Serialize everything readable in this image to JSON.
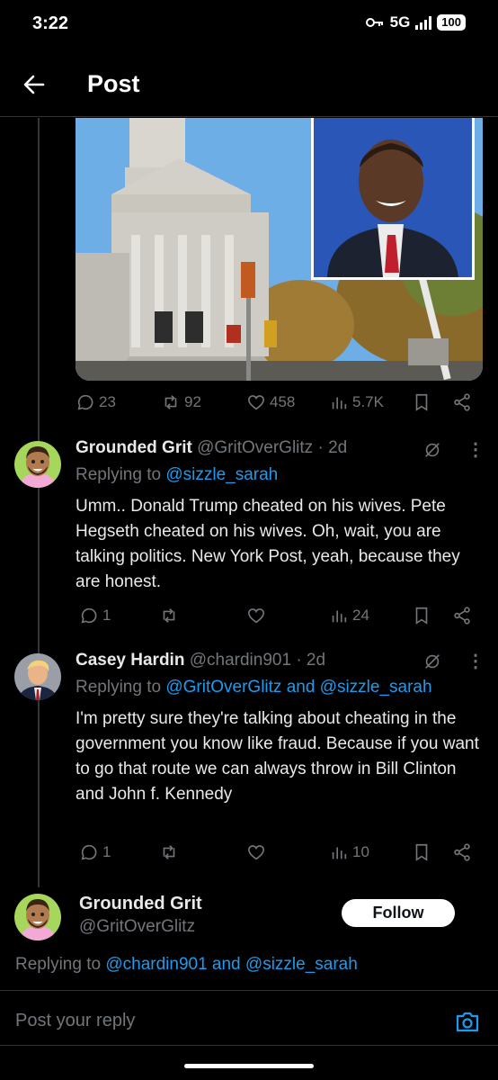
{
  "status_bar": {
    "time": "3:22",
    "network": "5G",
    "battery": "100"
  },
  "header": {
    "title": "Post"
  },
  "main_post": {
    "stats": {
      "replies": "23",
      "reposts": "92",
      "likes": "458",
      "views": "5.7K"
    }
  },
  "replies": [
    {
      "name": "Grounded Grit",
      "handle": "@GritOverGlitz",
      "time": "· 2d",
      "replying_prefix": "Replying to ",
      "replying_to": "@sizzle_sarah",
      "text": "Umm.. Donald Trump cheated on his wives. Pete Hegseth cheated on his wives. Oh, wait, you are talking politics.  New York Post, yeah, because they are honest.",
      "stats": {
        "replies": "1",
        "reposts": "",
        "likes": "",
        "views": "24"
      }
    },
    {
      "name": "Casey Hardin",
      "handle": "@chardin901",
      "time": "· 2d",
      "replying_prefix": "Replying to ",
      "replying_to": "@GritOverGlitz and @sizzle_sarah",
      "text": "I'm pretty sure they're talking about cheating in the government you know like fraud. Because if you want to go that route we can always throw in Bill Clinton and John f. Kennedy",
      "stats": {
        "replies": "1",
        "reposts": "",
        "likes": "",
        "views": "10"
      }
    }
  ],
  "composer_author": {
    "name": "Grounded Grit",
    "handle": "@GritOverGlitz",
    "follow_label": "Follow",
    "replying_prefix": "Replying to ",
    "replying_to": "@chardin901 and @sizzle_sarah"
  },
  "composer": {
    "placeholder": "Post your reply"
  },
  "colors": {
    "accent": "#1d9bf0",
    "muted": "#71767b",
    "text": "#e7e9ea",
    "bg": "#000000"
  }
}
